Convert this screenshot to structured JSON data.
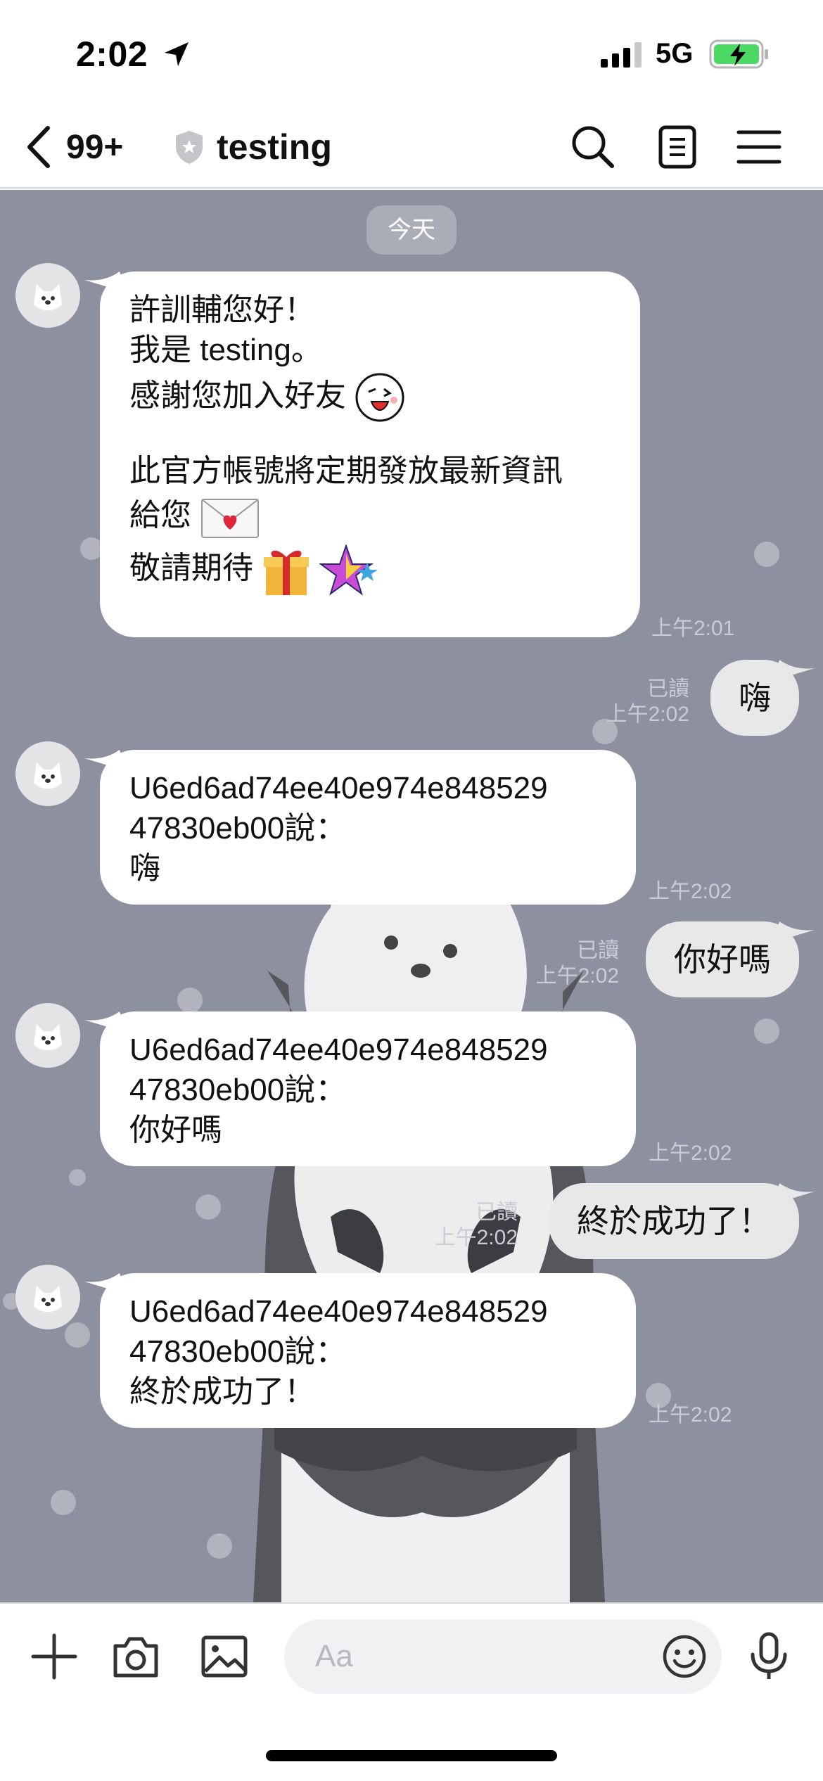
{
  "status_bar": {
    "time": "2:02",
    "network": "5G",
    "icons": [
      "location-arrow-icon",
      "cellular-signal-icon",
      "battery-charging-icon"
    ]
  },
  "header": {
    "unread_count": "99+",
    "title": "testing",
    "icons": [
      "back-chevron-icon",
      "shield-icon",
      "search-icon",
      "notes-icon",
      "menu-icon"
    ]
  },
  "chat": {
    "date_label": "今天",
    "messages": [
      {
        "direction": "incoming",
        "lines": [
          "許訓輔您好！",
          "我是 testing。",
          "感謝您加入好友",
          "",
          "此官方帳號將定期發放最新資訊",
          "給您",
          "敬請期待"
        ],
        "emojis": [
          "wink-face-emoji",
          "love-letter-emoji",
          "gift-emoji",
          "stars-emoji"
        ],
        "time": "上午2:01"
      },
      {
        "direction": "outgoing",
        "text": "嗨",
        "read": "已讀",
        "time": "上午2:02"
      },
      {
        "direction": "incoming",
        "lines": [
          "U6ed6ad74ee40e974e848529",
          "47830eb00說：",
          "嗨"
        ],
        "time": "上午2:02"
      },
      {
        "direction": "outgoing",
        "text": "你好嗎",
        "read": "已讀",
        "time": "上午2:02"
      },
      {
        "direction": "incoming",
        "lines": [
          "U6ed6ad74ee40e974e848529",
          "47830eb00說：",
          "你好嗎"
        ],
        "time": "上午2:02"
      },
      {
        "direction": "outgoing",
        "text": "終於成功了！",
        "read": "已讀",
        "time": "上午2:02"
      },
      {
        "direction": "incoming",
        "lines": [
          "U6ed6ad74ee40e974e848529",
          "47830eb00說：",
          "終於成功了！"
        ],
        "time": "上午2:02"
      }
    ]
  },
  "input_bar": {
    "placeholder": "Aa",
    "icons": [
      "plus-icon",
      "camera-icon",
      "image-icon",
      "emoji-icon",
      "microphone-icon"
    ]
  },
  "colors": {
    "chat_background": "#8d919f",
    "incoming_bubble": "#ffffff",
    "outgoing_bubble": "#e8e8e9",
    "battery_fill": "#4cd964"
  }
}
